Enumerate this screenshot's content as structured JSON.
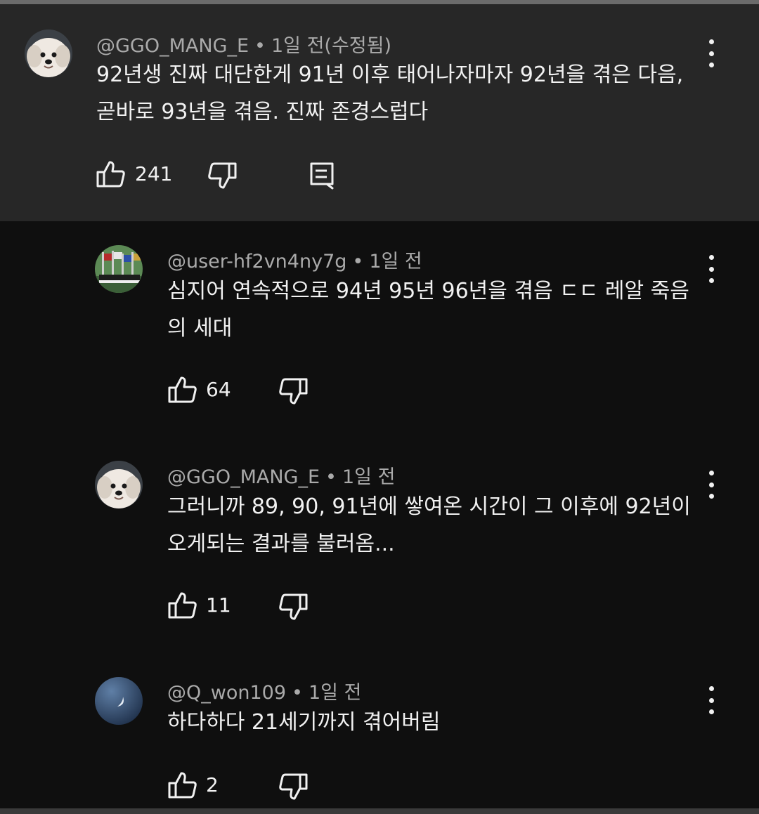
{
  "comments": [
    {
      "author": "@GGO_MANG_E",
      "timestamp": "1일 전(수정됨)",
      "text": "92년생 진짜 대단한게 91년 이후 태어나자마자 92년을 겪은 다음, 곧바로 93년을 겪음. 진짜 존경스럽다",
      "likes": "241",
      "avatar_icon": "puppy-avatar-icon"
    },
    {
      "author": "@user-hf2vn4ny7g",
      "timestamp": "1일 전",
      "text": "심지어 연속적으로 94년 95년 96년을 겪음 ㄷㄷ 레알 죽음의 세대",
      "likes": "64",
      "avatar_icon": "parade-flags-avatar-icon"
    },
    {
      "author": "@GGO_MANG_E",
      "timestamp": "1일 전",
      "text": "그러니까 89, 90, 91년에 쌓여온 시간이 그 이후에 92년이 오게되는 결과를 불러옴...",
      "likes": "11",
      "avatar_icon": "puppy-avatar-icon"
    },
    {
      "author": "@Q_won109",
      "timestamp": "1일 전",
      "text": "하다하다 21세기까지 겪어버림",
      "likes": "2",
      "avatar_icon": "crescent-moon-avatar-icon"
    }
  ],
  "colors": {
    "background": "#0f0f0f",
    "parent_panel": "#272727",
    "meta_text": "#aaaaaa",
    "text": "#f1f1f1"
  }
}
